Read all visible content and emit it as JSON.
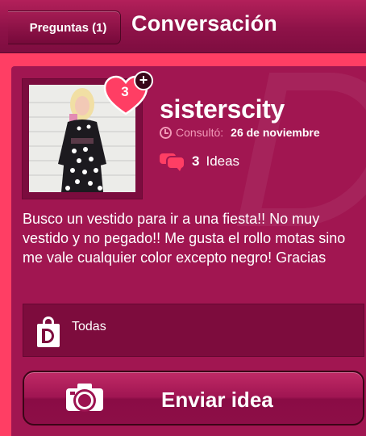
{
  "header": {
    "back_label": "Preguntas (1)",
    "title": "Conversación"
  },
  "question": {
    "ideas_badge": "3",
    "badge_plus": "+",
    "username": "sisterscity",
    "consult_label": "Consultó:",
    "consult_date": "26 de noviembre",
    "ideas_count": "3",
    "ideas_label": "Ideas",
    "text": "Busco un vestido para ir a una fiesta!! No muy vestido y no pegado!! Me gusta el rollo motas sino me vale cualquier color excepto negro! Gracias"
  },
  "category": {
    "label": "Todas",
    "icon": "shopping-bag-icon"
  },
  "send_button": {
    "label": "Enviar idea",
    "icon": "camera-icon"
  },
  "colors": {
    "background": "#ff3e64",
    "panel": "#a11651",
    "header": "#8e1248",
    "accent_pink": "#f29ab8"
  }
}
